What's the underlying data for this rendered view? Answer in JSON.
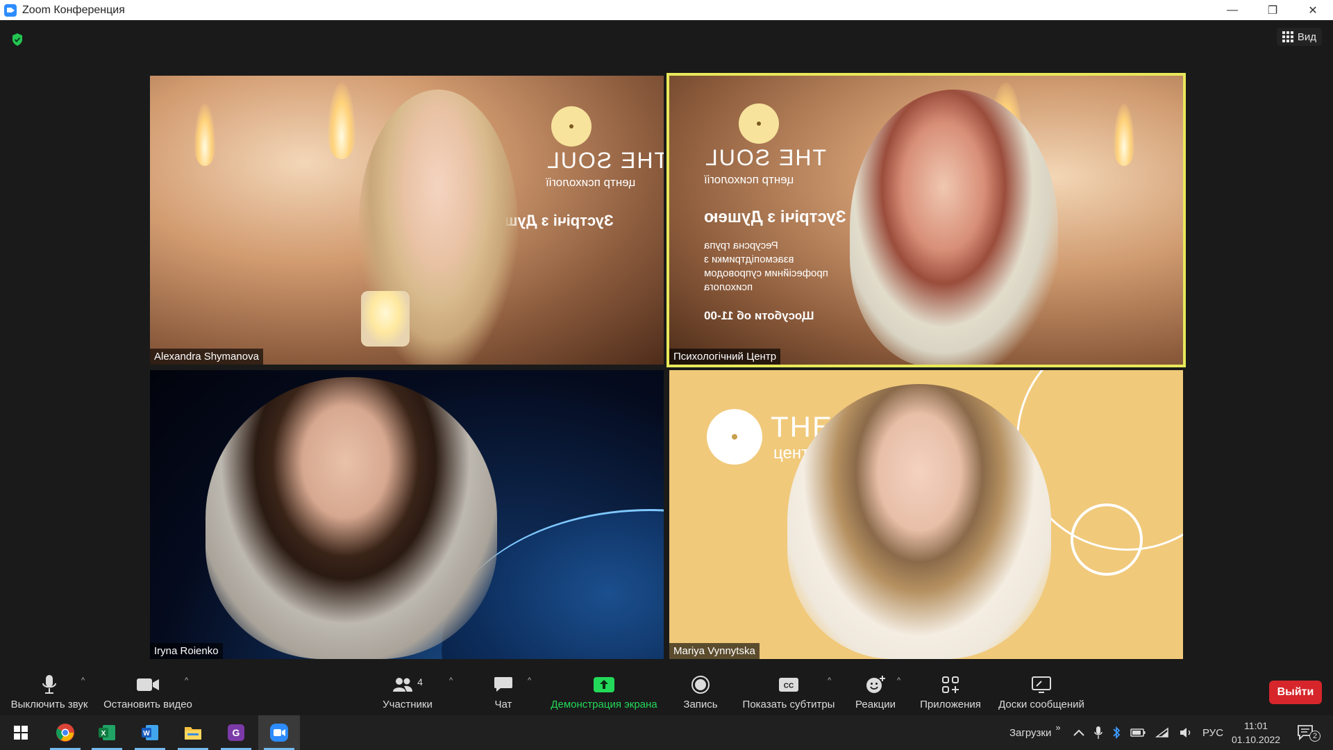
{
  "window": {
    "title": "Zoom Конференция",
    "minimize": "—",
    "restore": "❐",
    "close": "✕"
  },
  "top": {
    "view_label": "Вид"
  },
  "participants": [
    {
      "name": "Alexandra Shymanova"
    },
    {
      "name": "Психологічний Центр",
      "active_speaker": true
    },
    {
      "name": "Iryna Roienko"
    },
    {
      "name": "Mariya Vynnytska"
    }
  ],
  "background_text": {
    "brand": "THE SOUL",
    "brand_sub": "центр психології",
    "event": "Зустрічі з Душею",
    "desc": [
      "Ресурсна група",
      "взаємопідтримки з",
      "професійним супроводом",
      "психолога"
    ],
    "schedule": "Щосуботи об 11-00",
    "yellow_brand": "THE SO",
    "yellow_sub": "центр псих"
  },
  "toolbar": {
    "mute": "Выключить звук",
    "stop_video": "Остановить видео",
    "participants": "Участники",
    "participants_count": "4",
    "chat": "Чат",
    "share_screen": "Демонстрация экрана",
    "record": "Запись",
    "captions": "Показать субтитры",
    "reactions": "Реакции",
    "apps": "Приложения",
    "whiteboards": "Доски сообщений",
    "leave": "Выйти",
    "caret": "^"
  },
  "taskbar": {
    "downloads": "Загрузки",
    "chevrons": "»",
    "language": "РУС",
    "time": "11:01",
    "date": "01.10.2022",
    "notifications": "2"
  },
  "colors": {
    "active_border": "#e8e85a",
    "share_green": "#23d959",
    "leave_red": "#d6262b",
    "zoom_blue": "#2d8cff"
  }
}
